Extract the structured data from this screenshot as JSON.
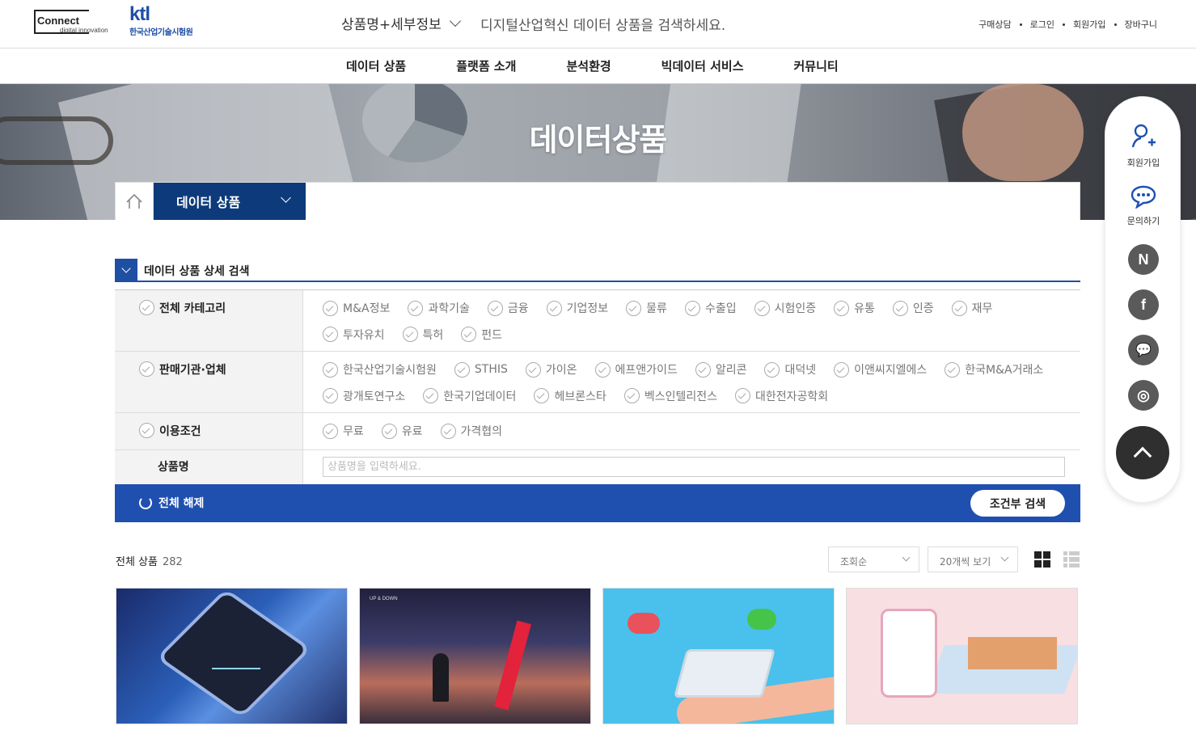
{
  "brand": {
    "connect_logo": "Connect",
    "connect_sub": "digital innovation",
    "ktl_logo": "ktl",
    "ktl_name": "한국산업기술시험원"
  },
  "search": {
    "type_label": "상품명+세부정보",
    "placeholder": "디지털산업혁신 데이터 상품을 검색하세요."
  },
  "util_links": [
    "구매상담",
    "로그인",
    "회원가입",
    "장바구니"
  ],
  "gnb": [
    "데이터 상품",
    "플랫폼 소개",
    "분석환경",
    "빅데이터 서비스",
    "커뮤니티"
  ],
  "hero": {
    "title": "데이터상품"
  },
  "breadcrumb": {
    "current": "데이터 상품"
  },
  "detail_search": {
    "title": "데이터 상품 상세 검색",
    "category": {
      "label": "전체 카테고리",
      "options": [
        "M&A정보",
        "과학기술",
        "금융",
        "기업정보",
        "물류",
        "수출입",
        "시험인증",
        "유통",
        "인증",
        "재무",
        "투자유치",
        "특허",
        "펀드"
      ]
    },
    "seller": {
      "label": "판매기관·업체",
      "options": [
        "한국산업기술시험원",
        "STHIS",
        "가이온",
        "에프앤가이드",
        "알리콘",
        "대덕넷",
        "이앤씨지엘에스",
        "한국M&A거래소",
        "광개토연구소",
        "한국기업데이터",
        "헤브론스타",
        "벡스인텔리전스",
        "대한전자공학회"
      ]
    },
    "terms": {
      "label": "이용조건",
      "options": [
        "무료",
        "유료",
        "가격협의"
      ]
    },
    "name": {
      "label": "상품명",
      "placeholder": "상품명을 입력하세요."
    },
    "reset_label": "전체 해제",
    "submit_label": "조건부 검색"
  },
  "results": {
    "total_label": "전체 상품",
    "total_count": "282",
    "sort_value": "조회순",
    "per_page_value": "20개씩 보기"
  },
  "card2_caption": "UP & DOWN",
  "quick_menu": {
    "join_label": "회원가입",
    "inquiry_label": "문의하기",
    "sns": [
      "N",
      "f",
      "💬",
      "◎"
    ]
  }
}
